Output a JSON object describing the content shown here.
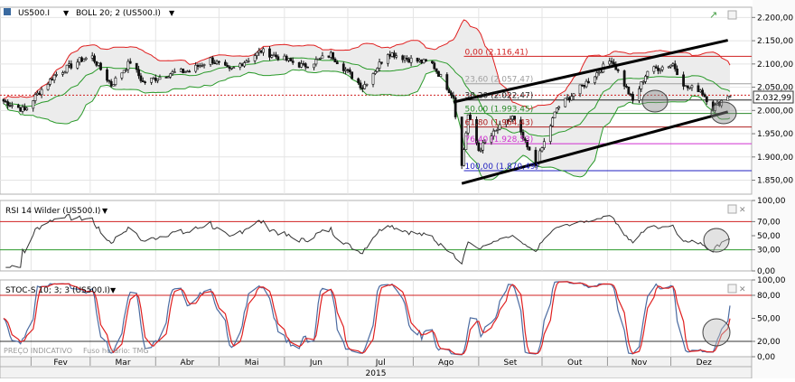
{
  "chart_data": [
    {
      "type": "line",
      "title": "US500.I",
      "indicator": "BOLL 20; 2 (US500.I)",
      "ylim": [
        1820,
        2222
      ],
      "y_ticks": [
        "2.200,00",
        "2.150,00",
        "2.100,00",
        "2.050,00",
        "2.000,00",
        "1.950,00",
        "1.900,00",
        "1.850,00"
      ],
      "last_price": {
        "value": 2032.99,
        "label": "2.032,99"
      },
      "fibonacci_levels": [
        {
          "label": "0,00 (2.116,41)",
          "value": 2116.41,
          "color": "#d02020"
        },
        {
          "label": "23,60 (2.057,47)",
          "value": 2057.47,
          "color": "#a0a0a0"
        },
        {
          "label": "38,20 (2.022,47)",
          "value": 2022.47,
          "color": "#202020"
        },
        {
          "label": "50,00 (1.993,45)",
          "value": 1993.45,
          "color": "#2a8a2a"
        },
        {
          "label": "61,80 (1.964,43)",
          "value": 1964.43,
          "color": "#b02020"
        },
        {
          "label": "76,40 (1.928,53)",
          "value": 1928.53,
          "color": "#d030d0"
        },
        {
          "label": "100,00 (1.870,49)",
          "value": 1870.49,
          "color": "#2020c0"
        }
      ],
      "series": [
        {
          "role": "price",
          "color": "#111111"
        },
        {
          "role": "bollinger-upper",
          "color": "#e02020"
        },
        {
          "role": "bollinger-middle",
          "color": "#2a9a2a"
        },
        {
          "role": "bollinger-lower",
          "color": "#2a9a2a"
        }
      ],
      "trend_channel": {
        "upper": [
          [
            "2015-08-20",
            2018
          ],
          [
            "2015-12-28",
            2151
          ]
        ],
        "lower": [
          [
            "2015-08-24",
            1843
          ],
          [
            "2015-12-28",
            1997
          ]
        ]
      }
    },
    {
      "type": "line",
      "title": "RSI 14 Wilder (US500.I)",
      "ylim": [
        0,
        100
      ],
      "y_ticks": [
        "100,00",
        "70,00",
        "50,00",
        "30,00",
        "0,00"
      ],
      "levels": [
        {
          "value": 70,
          "label": "70,00",
          "color": "#d02020"
        },
        {
          "value": 30,
          "label": "30,00",
          "color": "#2a9a2a"
        }
      ]
    },
    {
      "type": "line",
      "title": "STOC-S 10; 3; 3 (US500.I)",
      "ylim": [
        0,
        100
      ],
      "y_ticks": [
        "100,00",
        "80,00",
        "50,00",
        "20,00",
        "0,00"
      ],
      "levels": [
        {
          "value": 80,
          "label": "80,00",
          "color": "#d02020"
        },
        {
          "value": 20,
          "label": "20,00",
          "color": "#2a9a2a"
        }
      ],
      "series": [
        {
          "role": "%K",
          "color": "#4a6aa0"
        },
        {
          "role": "%D",
          "color": "#e02020"
        }
      ]
    }
  ],
  "x_axis": {
    "months": [
      "Fev",
      "Mar",
      "Abr",
      "Mai",
      "Jun",
      "Jul",
      "Ago",
      "Set",
      "Out",
      "Nov",
      "Dez"
    ],
    "year": "2015"
  },
  "footer": {
    "price_type": "PREÇO INDICATIVO",
    "timezone": "Fuso horário: TMG"
  },
  "colors": {
    "grid": "#e4e4e4",
    "band_fill": "#ececec",
    "axis_bg": "#f2f2f2"
  }
}
